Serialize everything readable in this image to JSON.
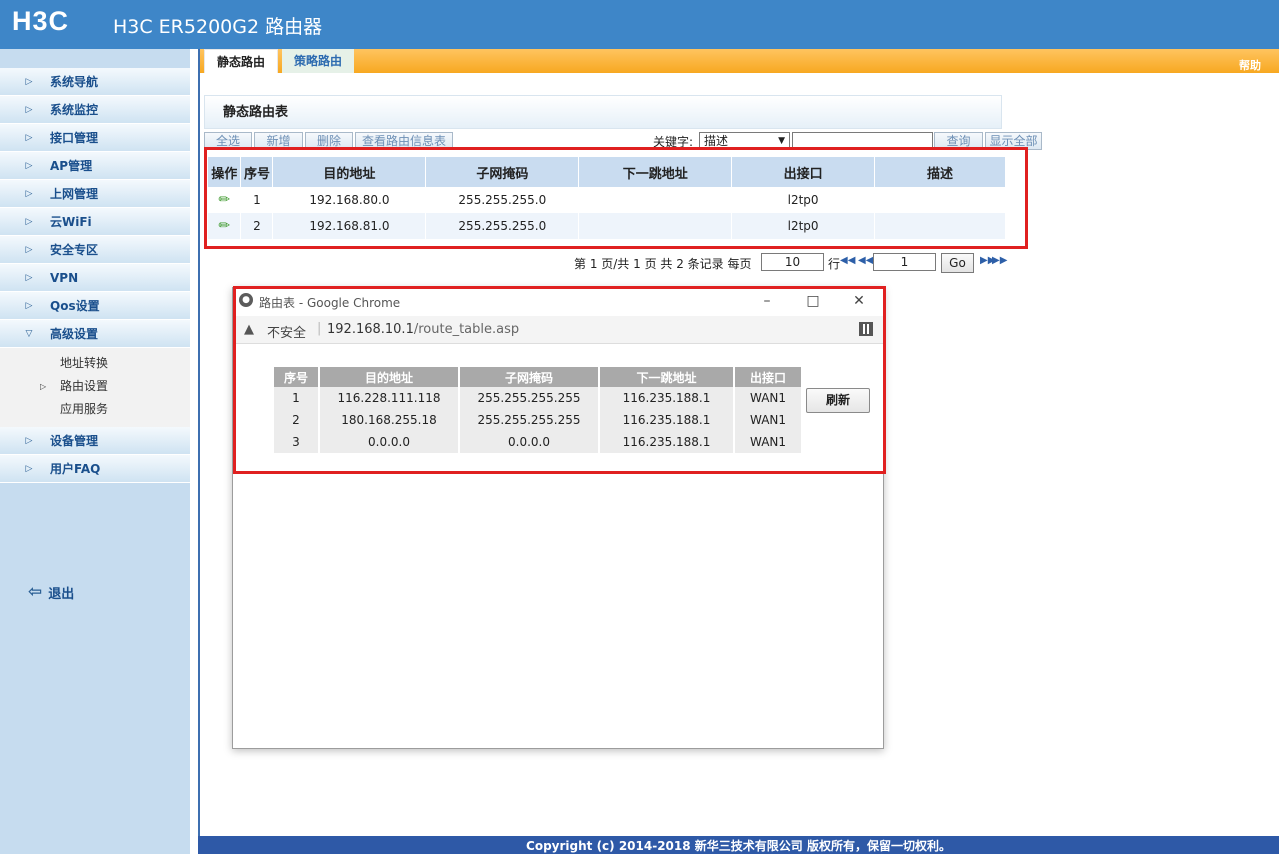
{
  "header": {
    "logo": "H3C",
    "title": "H3C ER5200G2 路由器"
  },
  "sidebar": {
    "items": [
      {
        "label": "系统导航"
      },
      {
        "label": "系统监控"
      },
      {
        "label": "接口管理"
      },
      {
        "label": "AP管理"
      },
      {
        "label": "上网管理"
      },
      {
        "label": "云WiFi"
      },
      {
        "label": "安全专区"
      },
      {
        "label": "VPN"
      },
      {
        "label": "Qos设置"
      },
      {
        "label": "高级设置"
      }
    ],
    "sub_items": [
      {
        "label": "地址转换",
        "active": false
      },
      {
        "label": "路由设置",
        "active": true
      },
      {
        "label": "应用服务",
        "active": false
      }
    ],
    "items_after": [
      {
        "label": "设备管理"
      },
      {
        "label": "用户FAQ"
      }
    ],
    "logout": "退出"
  },
  "tabs": {
    "static": "静态路由",
    "policy": "策略路由",
    "help": "帮助"
  },
  "section_title": "静态路由表",
  "toolbar": {
    "select_all": "全选",
    "add": "新增",
    "delete": "删除",
    "view_info": "查看路由信息表",
    "keyword_label": "关键字:",
    "keyword_select": "描述",
    "keyword_value": "",
    "search": "查询",
    "show_all": "显示全部"
  },
  "route_table": {
    "headers": [
      "操作",
      "序号",
      "目的地址",
      "子网掩码",
      "下一跳地址",
      "出接口",
      "描述"
    ],
    "rows": [
      {
        "no": "1",
        "dest": "192.168.80.0",
        "mask": "255.255.255.0",
        "next_hop": "",
        "iface": "l2tp0",
        "desc": ""
      },
      {
        "no": "2",
        "dest": "192.168.81.0",
        "mask": "255.255.255.0",
        "next_hop": "",
        "iface": "l2tp0",
        "desc": ""
      }
    ]
  },
  "pager": {
    "text_before": "第 1 页/共 1 页 共 2 条记录 每页",
    "page_size": "10",
    "row_label": "行",
    "page_input": "1",
    "go": "Go"
  },
  "popup": {
    "title": "路由表 - Google Chrome",
    "insecure": "不安全",
    "url_host": "192.168.10.1",
    "url_path": "/route_table.asp",
    "table": {
      "headers": [
        "序号",
        "目的地址",
        "子网掩码",
        "下一跳地址",
        "出接口"
      ],
      "rows": [
        [
          "1",
          "116.228.111.118",
          "255.255.255.255",
          "116.235.188.1",
          "WAN1"
        ],
        [
          "2",
          "180.168.255.18",
          "255.255.255.255",
          "116.235.188.1",
          "WAN1"
        ],
        [
          "3",
          "0.0.0.0",
          "0.0.0.0",
          "116.235.188.1",
          "WAN1"
        ]
      ]
    },
    "refresh": "刷新"
  },
  "footer": "Copyright (c) 2014-2018 新华三技术有限公司 版权所有，保留一切权利。"
}
